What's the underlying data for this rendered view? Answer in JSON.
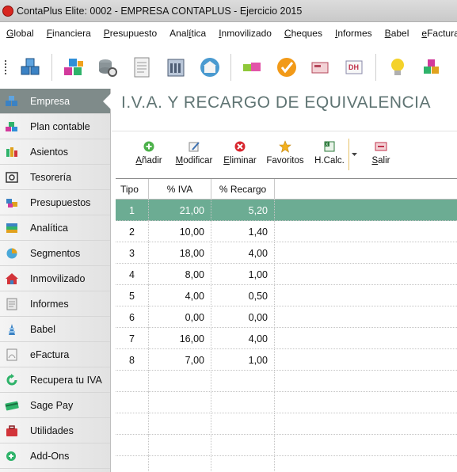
{
  "window": {
    "title": "ContaPlus Elite: 0002 - EMPRESA CONTAPLUS - Ejercicio 2015"
  },
  "menu": [
    {
      "pre": "",
      "ul": "G",
      "post": "lobal"
    },
    {
      "pre": "",
      "ul": "F",
      "post": "inanciera"
    },
    {
      "pre": "",
      "ul": "P",
      "post": "resupuesto"
    },
    {
      "pre": "Anal",
      "ul": "í",
      "post": "tica"
    },
    {
      "pre": "",
      "ul": "I",
      "post": "nmovilizado"
    },
    {
      "pre": "",
      "ul": "C",
      "post": "heques"
    },
    {
      "pre": "",
      "ul": "I",
      "post": "nformes"
    },
    {
      "pre": "",
      "ul": "B",
      "post": "abel"
    },
    {
      "pre": "",
      "ul": "e",
      "post": "Factura"
    }
  ],
  "toolbar_icons": [
    "company-cubes-icon",
    "cubes-stack-icon",
    "database-search-icon",
    "document-icon",
    "calendar-building-icon",
    "bank-icon",
    "colored-blocks-icon",
    "check-circle-icon",
    "receipt-icon",
    "dh-document-icon",
    "lightbulb-icon",
    "modules-cubes-icon"
  ],
  "colors": {
    "accent": "#6cac93",
    "title": "#5f7473",
    "sidebar_active": "#7f8b8a"
  },
  "sidebar": {
    "items": [
      {
        "label": "Empresa",
        "icon": "empresa-icon",
        "active": true
      },
      {
        "label": "Plan contable",
        "icon": "plan-contable-icon"
      },
      {
        "label": "Asientos",
        "icon": "asientos-icon"
      },
      {
        "label": "Tesorería",
        "icon": "tesoreria-icon"
      },
      {
        "label": "Presupuestos",
        "icon": "presupuestos-icon"
      },
      {
        "label": "Analítica",
        "icon": "analitica-icon"
      },
      {
        "label": "Segmentos",
        "icon": "segmentos-icon"
      },
      {
        "label": "Inmovilizado",
        "icon": "inmovilizado-icon"
      },
      {
        "label": "Informes",
        "icon": "informes-icon"
      },
      {
        "label": "Babel",
        "icon": "babel-icon"
      },
      {
        "label": "eFactura",
        "icon": "efactura-icon"
      },
      {
        "label": "Recupera tu IVA",
        "icon": "recupera-iva-icon"
      },
      {
        "label": "Sage Pay",
        "icon": "sage-pay-icon"
      },
      {
        "label": "Utilidades",
        "icon": "utilidades-icon"
      },
      {
        "label": "Add-Ons",
        "icon": "add-ons-icon"
      }
    ]
  },
  "page": {
    "title": "I.V.A. Y RECARGO DE EQUIVALENCIA"
  },
  "actions": [
    {
      "label": "Añadir",
      "ul_index": 0,
      "icon": "add-icon"
    },
    {
      "label": "Modificar",
      "ul_index": 0,
      "icon": "edit-icon"
    },
    {
      "label": "Eliminar",
      "ul_index": 0,
      "icon": "delete-icon"
    },
    {
      "label": "Favoritos",
      "ul_index": -1,
      "icon": "star-icon"
    },
    {
      "label": "H.Calc.",
      "ul_index": -1,
      "icon": "spreadsheet-icon"
    },
    {
      "label": "Salir",
      "ul_index": 0,
      "icon": "exit-icon"
    }
  ],
  "table": {
    "columns": [
      "Tipo",
      "% IVA",
      "% Recargo"
    ],
    "rows": [
      [
        "1",
        "21,00",
        "5,20"
      ],
      [
        "2",
        "10,00",
        "1,40"
      ],
      [
        "3",
        "18,00",
        "4,00"
      ],
      [
        "4",
        "8,00",
        "1,00"
      ],
      [
        "5",
        "4,00",
        "0,50"
      ],
      [
        "6",
        "0,00",
        "0,00"
      ],
      [
        "7",
        "16,00",
        "4,00"
      ],
      [
        "8",
        "7,00",
        "1,00"
      ]
    ],
    "selected_row": 0,
    "empty_rows": 5
  }
}
